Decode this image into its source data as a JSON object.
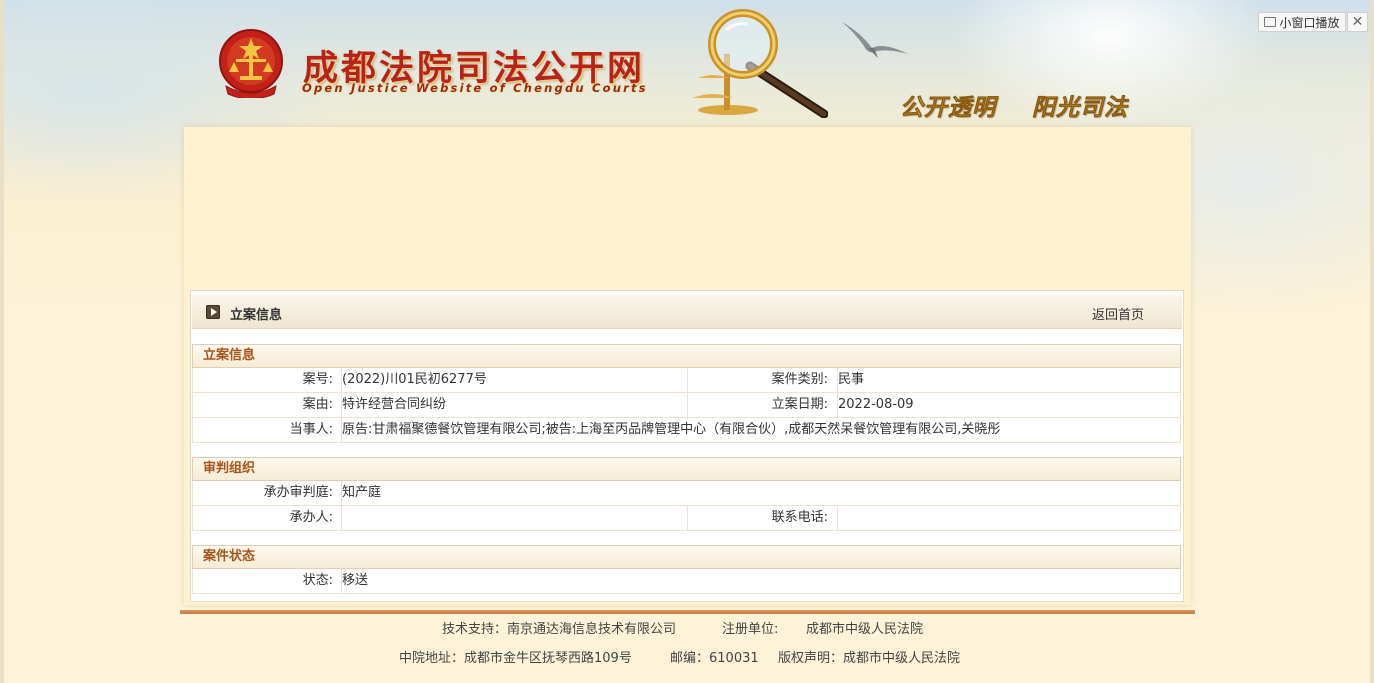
{
  "header": {
    "site_title": "成都法院司法公开网",
    "site_subtitle": "Open Justice Website of Chengdu Courts",
    "slogan_1": "公开透明",
    "slogan_2": "阳光司法"
  },
  "mini_player": {
    "label": "小窗口播放",
    "close": "✕"
  },
  "page": {
    "title": "立案信息",
    "home_link": "返回首页"
  },
  "filing": {
    "title": "立案信息",
    "case_no_label": "案号:",
    "case_no": "(2022)川01民初6277号",
    "case_type_label": "案件类别:",
    "case_type": "民事",
    "cause_label": "案由:",
    "cause": "特许经营合同纠纷",
    "filing_date_label": "立案日期:",
    "filing_date": "2022-08-09",
    "parties_label": "当事人:",
    "parties": "原告:甘肃福聚德餐饮管理有限公司;被告:上海至丙品牌管理中心（有限合伙）,成都天然呆餐饮管理有限公司,关晓彤"
  },
  "trial": {
    "title": "审判组织",
    "court_label": "承办审判庭:",
    "court": "知产庭",
    "judge_label": "承办人:",
    "judge": "",
    "phone_label": "联系电话:",
    "phone": ""
  },
  "status": {
    "title": "案件状态",
    "status_label": "状态:",
    "status": "移送"
  },
  "footer": {
    "tech_support": "技术支持：南京通达海信息技术有限公司",
    "registrant_label": "注册单位:",
    "registrant": "成都市中级人民法院",
    "address": "中院地址：成都市金牛区抚琴西路109号",
    "postcode": "邮编：610031",
    "copyright": "版权声明：成都市中级人民法院"
  }
}
